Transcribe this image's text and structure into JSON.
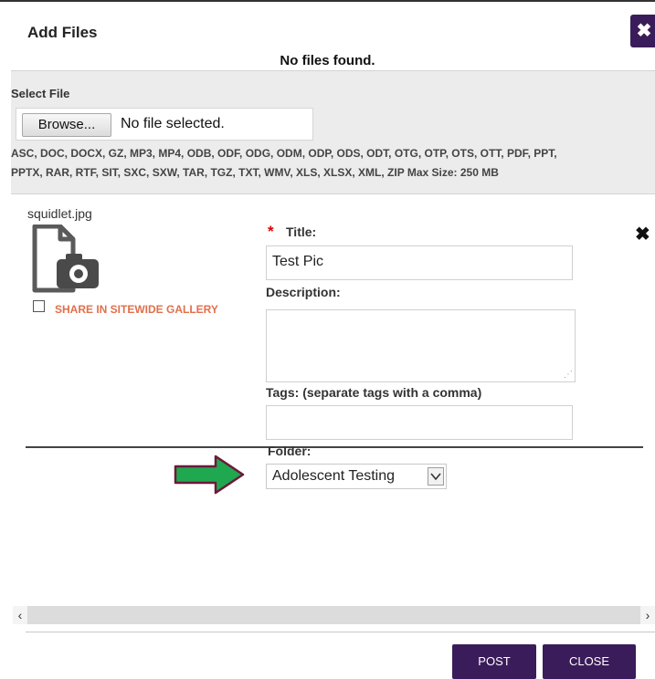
{
  "dialog": {
    "title": "Add Files",
    "close_glyph": "✖",
    "status_message": "No files found."
  },
  "select_file": {
    "label": "Select File",
    "browse_label": "Browse...",
    "no_file_text": "No file selected.",
    "allowed_types_line1": "ASC, DOC, DOCX, GZ, MP3, MP4, ODB, ODF, ODG, ODM, ODP, ODS, ODT, OTG, OTP, OTS, OTT, PDF, PPT,",
    "allowed_types_line2": "PPTX, RAR, RTF, SIT, SXC, SXW, TAR, TGZ, TXT, WMV, XLS, XLSX, XML, ZIP Max Size: 250 MB"
  },
  "file_item": {
    "filename": "squidlet.jpg",
    "icon": "image-file-icon",
    "share_label": "SHARE IN SITEWIDE GALLERY",
    "share_checked": false,
    "remove_glyph": "✖"
  },
  "form": {
    "required_marker": "*",
    "title_label": "Title:",
    "title_value": "Test Pic",
    "description_label": "Description:",
    "description_value": "",
    "tags_label": "Tags: (separate tags with a comma)",
    "tags_value": "",
    "folder_label": "Folder:",
    "folder_value": "Adolescent Testing"
  },
  "footer": {
    "post_label": "POST",
    "close_label": "CLOSE"
  },
  "colors": {
    "brand_purple": "#3b1c5a",
    "share_label": "#e0704c",
    "arrow_green": "#1fa84f",
    "arrow_border": "#6b1a3a",
    "required_red": "#dd0000"
  }
}
